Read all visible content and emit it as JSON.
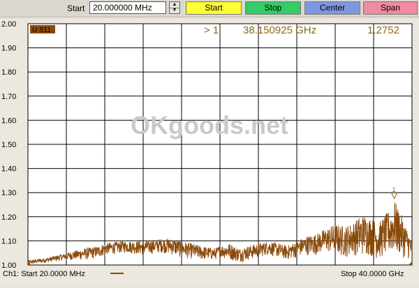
{
  "toolbar": {
    "start_label": "Start",
    "start_value": "20.000000 MHz",
    "buttons": {
      "start": "Start",
      "stop": "Stop",
      "center": "Center",
      "span": "Span"
    },
    "button_colors": {
      "start": "#ffff33",
      "stop": "#33cc66",
      "center": "#7e97e0",
      "span": "#f08aa0"
    }
  },
  "trace": {
    "label": "U S11",
    "color": "#8b4a0a"
  },
  "marker": {
    "prefix": "> 1:",
    "frequency": "38.150925 GHz",
    "value": "1.2752",
    "number": "1",
    "color": "#8b6914"
  },
  "watermark": "OKgoods.net",
  "footer": {
    "left": "Ch1: Start  20.0000  MHz",
    "right": "Stop  40.0000  GHz"
  },
  "chart_data": {
    "type": "line",
    "y_ticks": [
      "2.00",
      "1.90",
      "1.80",
      "1.70",
      "1.60",
      "1.50",
      "1.40",
      "1.30",
      "1.20",
      "1.10",
      "1.00"
    ],
    "ylim": [
      1.0,
      2.0
    ],
    "xlim_ghz": [
      0.02,
      40.0
    ],
    "grid": true,
    "x_divisions": 10,
    "y_divisions": 10,
    "marker_point": {
      "x_ghz": 38.150925,
      "y": 1.2752
    },
    "series": [
      {
        "envelope": {
          "x_ghz": [
            0.02,
            2,
            4,
            6,
            7.5,
            8,
            10,
            12,
            14,
            15,
            16,
            18,
            19.5,
            20,
            21,
            22,
            23,
            24,
            25,
            26,
            27,
            28,
            29,
            30,
            31,
            32,
            33,
            34,
            34.5,
            35,
            36,
            36.5,
            37,
            38,
            38.15,
            39,
            40
          ],
          "y_max": [
            1.02,
            1.03,
            1.05,
            1.07,
            1.08,
            1.09,
            1.1,
            1.1,
            1.11,
            1.11,
            1.1,
            1.08,
            1.07,
            1.08,
            1.09,
            1.07,
            1.08,
            1.09,
            1.1,
            1.09,
            1.08,
            1.1,
            1.12,
            1.13,
            1.15,
            1.17,
            1.16,
            1.18,
            1.2,
            1.21,
            1.19,
            1.17,
            1.2,
            1.24,
            1.27,
            1.2,
            1.1
          ],
          "y_min": [
            1.0,
            1.01,
            1.02,
            1.02,
            1.03,
            1.04,
            1.05,
            1.04,
            1.05,
            1.04,
            1.03,
            1.02,
            1.02,
            1.03,
            1.02,
            1.01,
            1.02,
            1.03,
            1.04,
            1.03,
            1.02,
            1.03,
            1.04,
            1.04,
            1.05,
            1.04,
            1.03,
            1.04,
            1.03,
            1.04,
            1.03,
            1.02,
            1.03,
            1.04,
            1.04,
            1.03,
            1.02
          ]
        }
      }
    ]
  }
}
